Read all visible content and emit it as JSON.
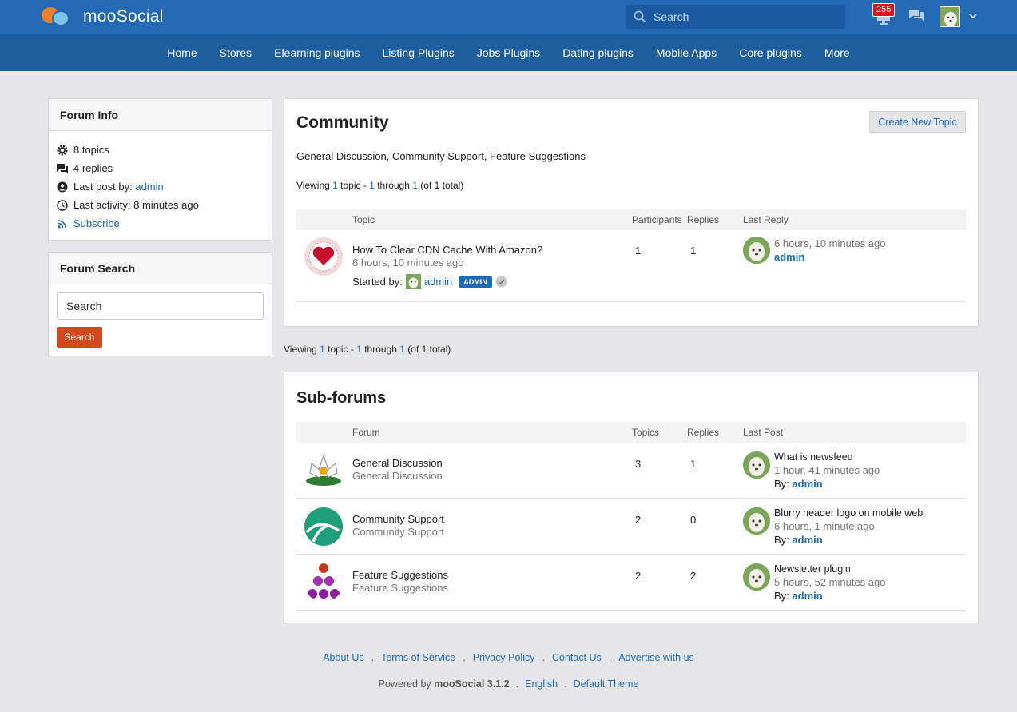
{
  "header": {
    "brand": "mooSocial",
    "search_placeholder": "Search",
    "notification_count": "255"
  },
  "nav": [
    "Home",
    "Stores",
    "Elearning plugins",
    "Listing Plugins",
    "Jobs Plugins",
    "Dating plugins",
    "Mobile Apps",
    "Core plugins",
    "More"
  ],
  "forum_info": {
    "title": "Forum Info",
    "topics": "8 topics",
    "replies": "4 replies",
    "last_post_label": "Last post by:",
    "last_post_user": "admin",
    "last_activity": "Last activity: 8 minutes ago",
    "subscribe": "Subscribe"
  },
  "forum_search": {
    "title": "Forum Search",
    "placeholder": "Search",
    "button": "Search"
  },
  "community": {
    "title": "Community",
    "create_button": "Create New Topic",
    "subforums_line": "General Discussion, Community Support, Feature Suggestions",
    "viewing": {
      "prefix": "Viewing ",
      "a": "1",
      "mid1": " topic - ",
      "b": "1",
      "mid2": " through ",
      "c": "1",
      "suffix": " (of 1 total)"
    },
    "columns": {
      "topic": "Topic",
      "participants": "Participants",
      "replies": "Replies",
      "last_reply": "Last Reply"
    },
    "topic": {
      "title": "How To Clear CDN Cache With Amazon?",
      "time": "6 hours, 10 minutes ago",
      "started_by": "Started by:",
      "author": "admin",
      "badge": "ADMIN",
      "participants": "1",
      "replies": "1",
      "last_reply_time": "6 hours, 10 minutes ago",
      "last_reply_user": "admin"
    }
  },
  "viewing_outside": {
    "prefix": "Viewing ",
    "a": "1",
    "mid1": " topic - ",
    "b": "1",
    "mid2": " through ",
    "c": "1",
    "suffix": " (of 1 total)"
  },
  "subforums": {
    "title": "Sub-forums",
    "columns": {
      "forum": "Forum",
      "topics": "Topics",
      "replies": "Replies",
      "last_post": "Last Post"
    },
    "by_label": "By:",
    "rows": [
      {
        "name": "General Discussion",
        "desc": "General Discussion",
        "topics": "3",
        "replies": "1",
        "last_title": "What is newsfeed",
        "last_time": "1 hour, 41 minutes ago",
        "last_user": "admin"
      },
      {
        "name": "Community Support",
        "desc": "Community Support",
        "topics": "2",
        "replies": "0",
        "last_title": "Blurry header logo on mobile web",
        "last_time": "6 hours, 1 minute ago",
        "last_user": "admin"
      },
      {
        "name": "Feature Suggestions",
        "desc": "Feature Suggestions",
        "topics": "2",
        "replies": "2",
        "last_title": "Newsletter plugin",
        "last_time": "5 hours, 52 minutes ago",
        "last_user": "admin"
      }
    ]
  },
  "footer": {
    "links": [
      "About Us",
      "Terms of Service",
      "Privacy Policy",
      "Contact Us",
      "Advertise with us"
    ],
    "powered_prefix": "Powered by ",
    "powered_brand": "mooSocial 3.1.2",
    "language": "English",
    "theme": "Default Theme"
  }
}
